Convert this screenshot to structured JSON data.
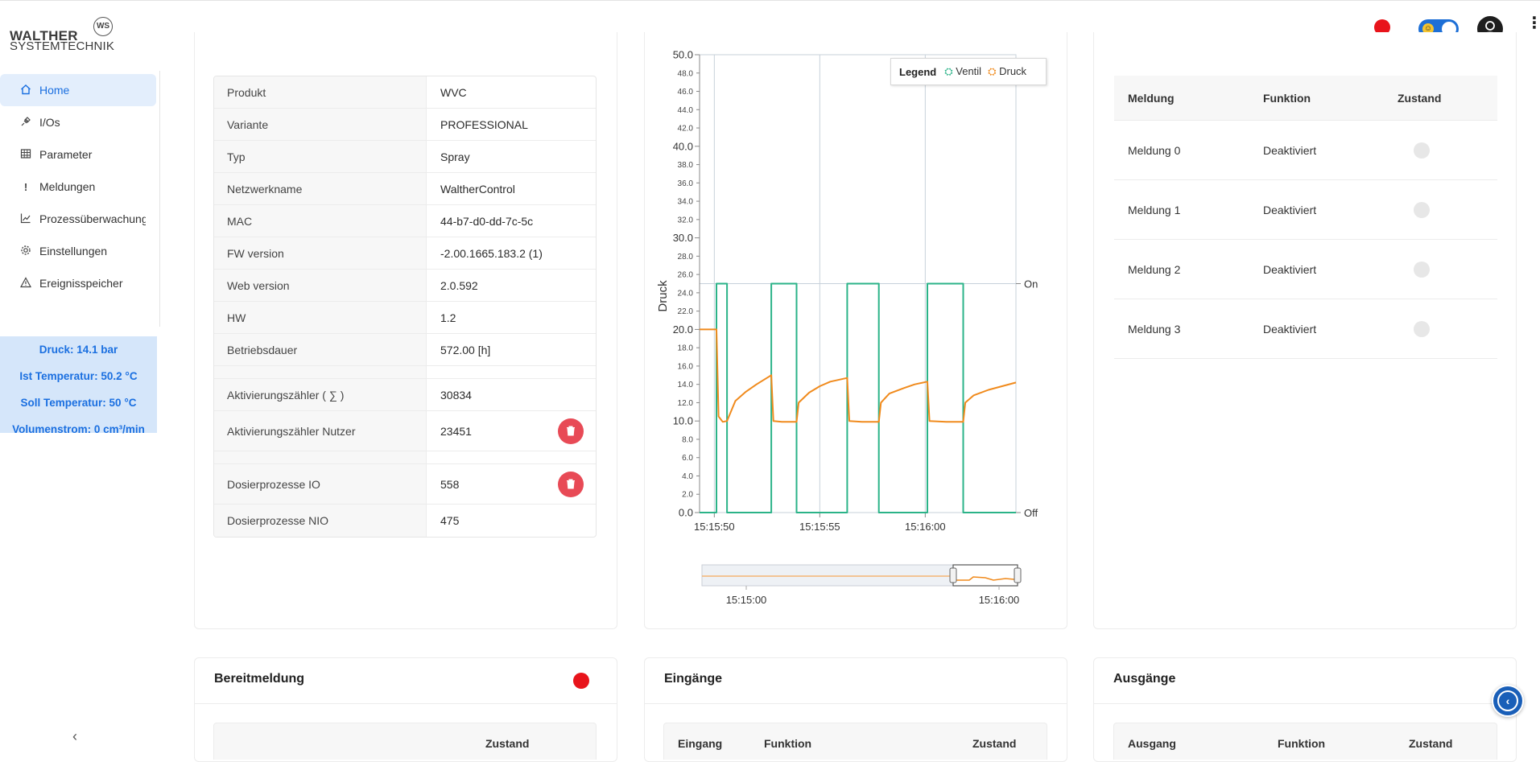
{
  "brand": {
    "line1": "WALTHER",
    "line2": "SYSTEMTECHNIK",
    "badge": "WS"
  },
  "header": {
    "status_color": "#e8141b"
  },
  "nav": [
    {
      "label": "Home",
      "icon": "home-icon",
      "active": true
    },
    {
      "label": "I/Os",
      "icon": "plug-icon"
    },
    {
      "label": "Parameter",
      "icon": "table-icon"
    },
    {
      "label": "Meldungen",
      "icon": "exclamation-icon"
    },
    {
      "label": "Prozessüberwachung",
      "icon": "chart-line-icon"
    },
    {
      "label": "Einstellungen",
      "icon": "gear-icon"
    },
    {
      "label": "Ereignisspeicher",
      "icon": "warning-icon"
    }
  ],
  "status": {
    "druck": "Druck: 14.1 bar",
    "ist_temp": "Ist Temperatur: 50.2 °C",
    "soll_temp": "Soll Temperatur: 50 °C",
    "volumenstrom": "Volumenstrom: 0 cm³/min"
  },
  "info": [
    {
      "key": "Produkt",
      "value": "WVC"
    },
    {
      "key": "Variante",
      "value": "PROFESSIONAL"
    },
    {
      "key": "Typ",
      "value": "Spray"
    },
    {
      "key": "Netzwerkname",
      "value": "WaltherControl"
    },
    {
      "key": "MAC",
      "value": "44-b7-d0-dd-7c-5c"
    },
    {
      "key": "FW version",
      "value": "-2.00.1665.183.2 (1)"
    },
    {
      "key": "Web version",
      "value": "2.0.592"
    },
    {
      "key": "HW",
      "value": "1.2"
    },
    {
      "key": "Betriebsdauer",
      "value": "572.00 [h]"
    },
    {
      "key": "",
      "value": ""
    },
    {
      "key": "Aktivierungszähler ( ∑ )",
      "value": "30834"
    },
    {
      "key": "Aktivierungszähler Nutzer",
      "value": "23451",
      "delete": true
    },
    {
      "key": "",
      "value": ""
    },
    {
      "key": "Dosierprozesse IO",
      "value": "558",
      "delete": true
    },
    {
      "key": "Dosierprozesse NIO",
      "value": "475"
    }
  ],
  "chart_data": {
    "type": "line",
    "ylabel": "Druck",
    "ylim": [
      0,
      50
    ],
    "y_major_ticks": [
      "0.0",
      "10.0",
      "20.0",
      "30.0",
      "40.0",
      "50.0"
    ],
    "y_minor_ticks": [
      "2.0",
      "4.0",
      "6.0",
      "8.0",
      "12.0",
      "14.0",
      "16.0",
      "18.0",
      "22.0",
      "24.0",
      "26.0",
      "28.0",
      "32.0",
      "34.0",
      "36.0",
      "38.0",
      "42.0",
      "44.0",
      "46.0",
      "48.0"
    ],
    "right_axis": [
      "Off",
      "On"
    ],
    "x_ticks": [
      "15:15:50",
      "15:15:55",
      "15:16:00"
    ],
    "xlim_seconds_after_15_15_50": [
      -0.7,
      14.3
    ],
    "legend": {
      "title": "Legend",
      "position": "top-right"
    },
    "series": [
      {
        "name": "Ventil",
        "color": "#2bb388",
        "axis": "right",
        "x": [
          -0.7,
          0.1,
          0.1,
          0.6,
          0.6,
          2.7,
          2.7,
          3.9,
          3.9,
          6.3,
          6.3,
          7.8,
          7.8,
          10.1,
          10.1,
          11.8,
          11.8,
          14.3
        ],
        "y": [
          0,
          0,
          1,
          1,
          0,
          0,
          1,
          1,
          0,
          0,
          1,
          1,
          0,
          0,
          1,
          1,
          0,
          0
        ]
      },
      {
        "name": "Druck",
        "color": "#f08a1c",
        "axis": "left",
        "x": [
          -0.7,
          0.1,
          0.2,
          0.4,
          0.6,
          1.0,
          1.5,
          2.0,
          2.7,
          2.8,
          3.2,
          3.9,
          4.0,
          4.5,
          5.0,
          5.5,
          6.3,
          6.4,
          7.0,
          7.8,
          7.9,
          8.3,
          9.0,
          9.5,
          10.1,
          10.2,
          11.0,
          11.8,
          11.9,
          12.3,
          13.0,
          14.3
        ],
        "y": [
          20.0,
          20.0,
          10.5,
          9.9,
          10.0,
          12.2,
          13.2,
          14.0,
          15.0,
          10.0,
          9.9,
          9.9,
          12.0,
          13.1,
          13.8,
          14.3,
          14.7,
          10.0,
          9.9,
          9.9,
          12.0,
          13.0,
          13.6,
          14.0,
          14.3,
          10.0,
          9.9,
          9.9,
          12.0,
          12.8,
          13.4,
          14.2
        ]
      }
    ],
    "navigator": {
      "x_ticks": [
        "15:15:00",
        "15:16:00"
      ]
    }
  },
  "meldungen": {
    "headers": [
      "Meldung",
      "Funktion",
      "Zustand"
    ],
    "rows": [
      {
        "name": "Meldung 0",
        "funktion": "Deaktiviert"
      },
      {
        "name": "Meldung 1",
        "funktion": "Deaktiviert"
      },
      {
        "name": "Meldung 2",
        "funktion": "Deaktiviert"
      },
      {
        "name": "Meldung 3",
        "funktion": "Deaktiviert"
      }
    ]
  },
  "bereit": {
    "title": "Bereitmeldung",
    "header_zustand": "Zustand",
    "status_color": "#e8141b"
  },
  "eingaenge": {
    "title": "Eingänge",
    "headers": [
      "Eingang",
      "Funktion",
      "Zustand"
    ]
  },
  "ausgaenge": {
    "title": "Ausgänge",
    "headers": [
      "Ausgang",
      "Funktion",
      "Zustand"
    ]
  }
}
